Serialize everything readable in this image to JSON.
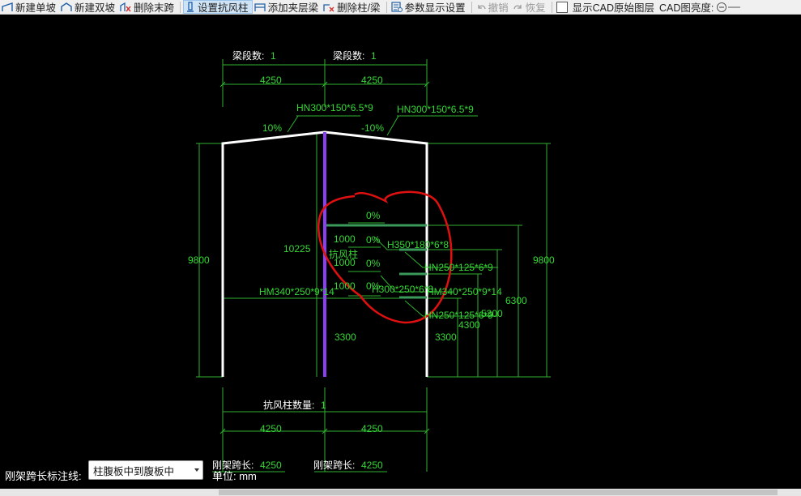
{
  "toolbar": {
    "items": [
      {
        "label": "新建单坡",
        "icon": "single-slope-icon"
      },
      {
        "label": "新建双坡",
        "icon": "double-slope-icon"
      },
      {
        "label": "删除末跨",
        "icon": "delete-span-icon"
      },
      {
        "label": "设置抗风柱",
        "icon": "wind-column-icon"
      },
      {
        "label": "添加夹层梁",
        "icon": "add-mezzanine-icon"
      },
      {
        "label": "删除柱/梁",
        "icon": "delete-member-icon"
      },
      {
        "label": "参数显示设置",
        "icon": "display-settings-icon"
      },
      {
        "label": "撤销",
        "icon": "undo-icon"
      },
      {
        "label": "恢复",
        "icon": "redo-icon"
      }
    ],
    "cad_layer_label": "显示CAD原始图层",
    "cad_brightness_label": "CAD图亮度:"
  },
  "drawing": {
    "segment_label_left": "梁段数:",
    "segment_value_left": "1",
    "segment_label_right": "梁段数:",
    "segment_value_right": "1",
    "top_dim_left": "4250",
    "top_dim_right": "4250",
    "rafter_left_section": "HN300*150*6.5*9",
    "rafter_right_section": "HN300*150*6.5*9",
    "slope_left": "10%",
    "slope_right": "-10%",
    "height_left": "9800",
    "height_right": "9800",
    "wind_col_height": "10225",
    "wind_col_label": "抗风柱",
    "column_left_section": "HM340*250*9*14",
    "column_right_section": "HM340*250*9*14",
    "beam_slope_1": "0%",
    "beam_slope_2": "0%",
    "beam_slope_3": "0%",
    "beam_slope_4": "0%",
    "beam_spacing_1": "1000",
    "beam_spacing_2": "1000",
    "beam_spacing_3": "1000",
    "beam_section_1": "H350*180*6*8",
    "beam_section_2": "HN250*125*6*9",
    "beam_section_3": "H300*250*6*8",
    "beam_section_4": "HN250*125*6*9",
    "dim_6300": "6300",
    "dim_5300": "5300",
    "dim_4300": "4300",
    "dim_3300_left": "3300",
    "dim_3300_right": "3300",
    "wind_col_count_label": "抗风柱数量:",
    "wind_col_count": "1",
    "bottom_dim_left": "4250",
    "bottom_dim_right": "4250",
    "span_label_left": "刚架跨长:",
    "span_value_left": "4250",
    "span_label_right": "刚架跨长:",
    "span_value_right": "4250"
  },
  "footer": {
    "span_annotation_label": "刚架跨长标注线:",
    "span_annotation_value": "柱腹板中到腹板中",
    "unit": "单位: mm"
  },
  "colors": {
    "dim_green": "#2fb02f",
    "text_green": "#36d836",
    "wind_column": "#8a3ff2",
    "beam": "#3a9a5a",
    "highlight": "#e01010"
  }
}
